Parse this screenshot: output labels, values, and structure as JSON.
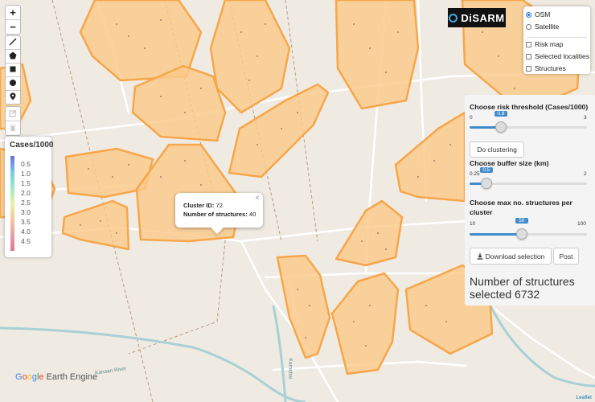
{
  "map": {
    "zoom_in": "+",
    "zoom_out": "−",
    "draw_tools": [
      "line-tool",
      "polygon-tool",
      "rectangle-tool",
      "circle-tool",
      "marker-tool"
    ],
    "edit_tools": [
      "edit-tool",
      "delete-tool"
    ],
    "river_labels": [
      "Kanaan River",
      "Kamabai"
    ],
    "attribution": "Leaflet",
    "google_earth_engine": {
      "g1": "G",
      "g2": "o",
      "g3": "o",
      "g4": "g",
      "g5": "l",
      "g6": "e",
      "rest": " Earth Engine"
    }
  },
  "legend": {
    "title": "Cases/1000",
    "ticks": [
      "0.5",
      "1.0",
      "1.5",
      "2.0",
      "2.5",
      "3.0",
      "3.5",
      "4.0",
      "4.5"
    ]
  },
  "logo": {
    "text": "DiSARM"
  },
  "layers": {
    "base": [
      {
        "label": "OSM",
        "selected": true
      },
      {
        "label": "Satellite",
        "selected": false
      }
    ],
    "overlays": [
      {
        "label": "Risk map"
      },
      {
        "label": "Selected localities"
      },
      {
        "label": "Structures"
      }
    ]
  },
  "panel": {
    "risk_label": "Choose risk threshold (Cases/1000)",
    "risk_min": "0",
    "risk_max": "3",
    "risk_value": "0.8",
    "risk_fraction": 0.267,
    "cluster_button": "Do clustering",
    "buffer_label": "Choose buffer size (km)",
    "buffer_min": "0.25",
    "buffer_max": "2",
    "buffer_value": "0.5",
    "buffer_fraction": 0.143,
    "structures_label": "Choose max no. structures per cluster",
    "structures_min": "10",
    "structures_max": "100",
    "structures_value": "50",
    "structures_fraction": 0.444,
    "download_button": "Download selection",
    "post_button": "Post",
    "summary": "Number of structures selected 6732"
  },
  "popup": {
    "cluster_label": "Cluster ID:",
    "cluster_id": "72",
    "structures_label": "Number of structures:",
    "structures_count": "40",
    "close": "×"
  },
  "colors": {
    "cluster_fill": "#fbc98a",
    "cluster_stroke": "#f7a64a",
    "accent": "#428bca"
  }
}
